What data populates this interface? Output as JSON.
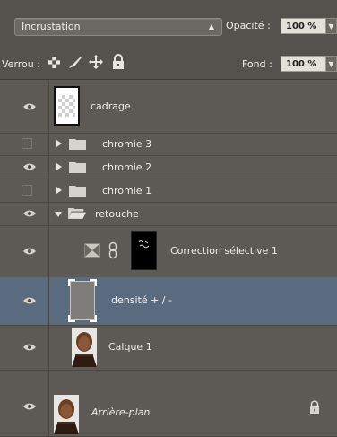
{
  "toolbar": {
    "blend_mode": "Incrustation",
    "opacity_label": "Opacité :",
    "opacity_value": "100 %",
    "lock_label": "Verrou :",
    "fill_label": "Fond :",
    "fill_value": "100 %"
  },
  "icons": {
    "visibility": "eye-icon",
    "lock_transparent": "checkerboard-icon",
    "lock_paint": "brush-icon",
    "lock_move": "move-icon",
    "lock_all": "padlock-icon",
    "group": "folder-icon",
    "link": "chain-icon"
  },
  "layers": [
    {
      "name": "cadrage",
      "visible": true,
      "type": "layer",
      "thumbnail": "transparent"
    },
    {
      "name": "chromie 3",
      "visible": false,
      "type": "group",
      "expanded": false
    },
    {
      "name": "chromie 2",
      "visible": true,
      "type": "group",
      "expanded": false
    },
    {
      "name": "chromie 1",
      "visible": false,
      "type": "group",
      "expanded": false
    },
    {
      "name": "retouche",
      "visible": true,
      "type": "group",
      "expanded": true
    },
    {
      "name": "Correction sélective 1",
      "visible": true,
      "type": "adjustment",
      "indent": true
    },
    {
      "name": "densité + / -",
      "visible": true,
      "type": "layer",
      "indent": true,
      "selected": true,
      "thumbnail": "gray"
    },
    {
      "name": "Calque 1",
      "visible": true,
      "type": "layer",
      "indent": true,
      "thumbnail": "portrait"
    },
    {
      "name": "Arrière-plan",
      "visible": true,
      "type": "background",
      "locked": true,
      "thumbnail": "portrait"
    }
  ],
  "colors": {
    "panel_bg": "#5d5a55",
    "selected_row": "#5b6b7f",
    "field_bg": "#e4e1d8"
  }
}
